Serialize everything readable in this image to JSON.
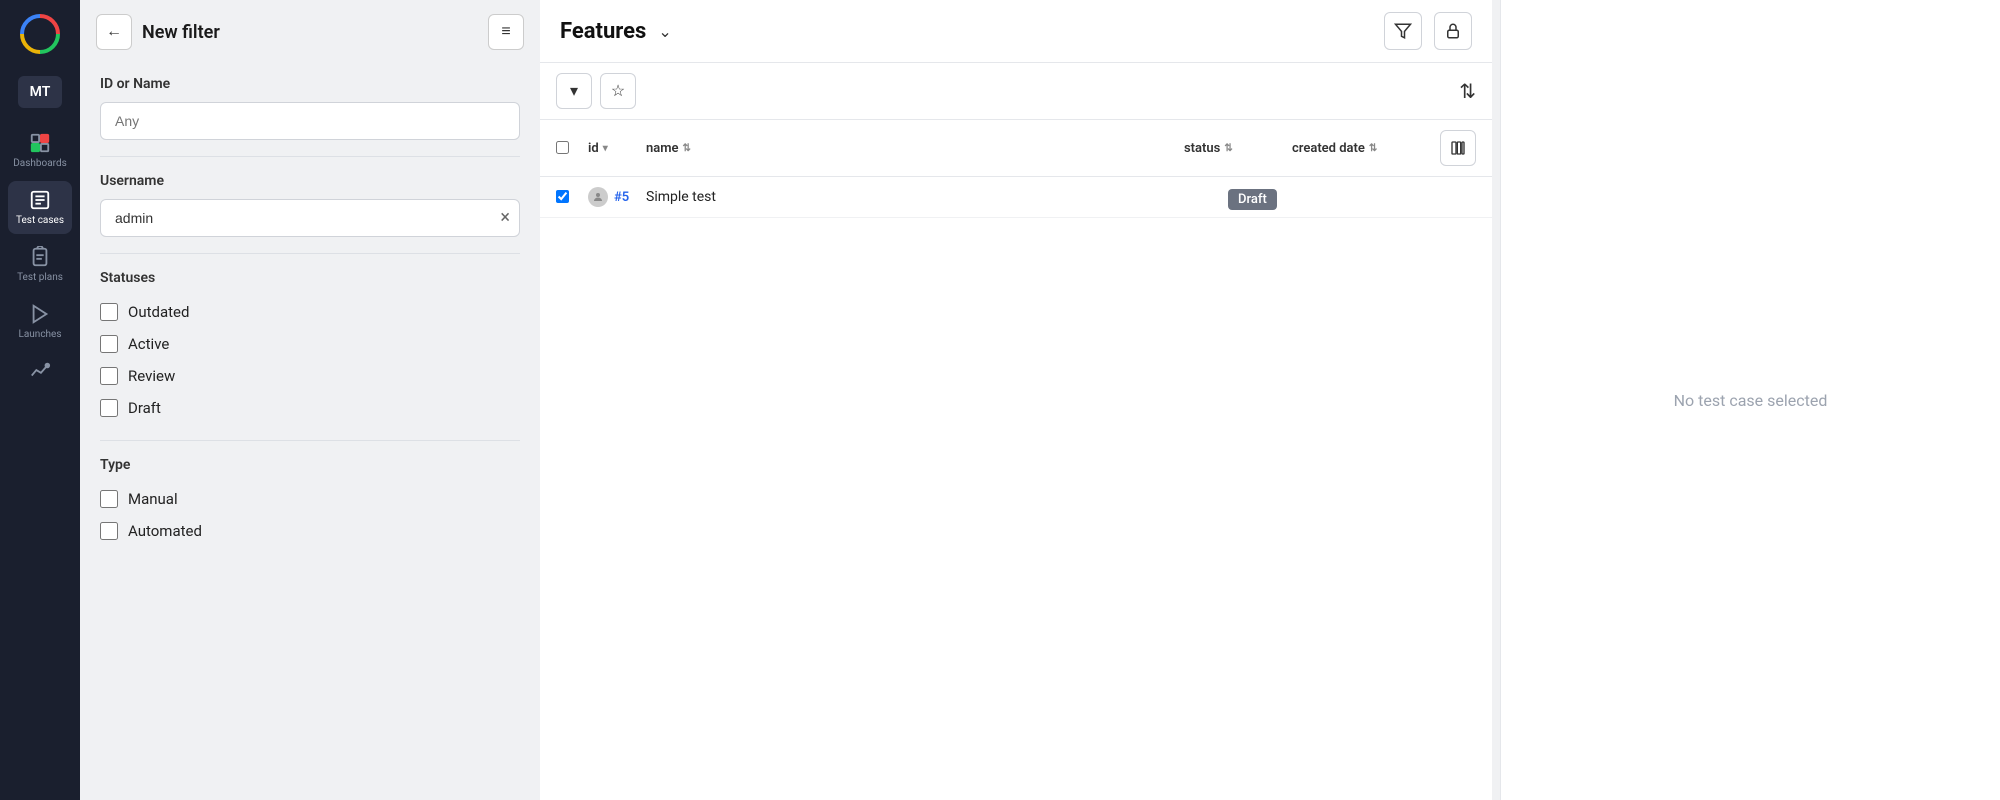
{
  "nav": {
    "logo_alt": "App logo",
    "user_badge": "MT",
    "items": [
      {
        "id": "dashboards",
        "label": "Dashboards",
        "icon": "grid-icon",
        "active": false
      },
      {
        "id": "test-cases",
        "label": "Test cases",
        "icon": "list-icon",
        "active": true
      },
      {
        "id": "test-plans",
        "label": "Test plans",
        "icon": "clipboard-icon",
        "active": false
      },
      {
        "id": "launches",
        "label": "Launches",
        "icon": "play-icon",
        "active": false
      },
      {
        "id": "analytics",
        "label": "",
        "icon": "chart-icon",
        "active": false
      }
    ]
  },
  "filter": {
    "back_label": "←",
    "title": "New filter",
    "menu_label": "≡",
    "id_or_name_label": "ID or Name",
    "id_or_name_placeholder": "Any",
    "username_label": "Username",
    "username_value": "admin",
    "statuses_label": "Statuses",
    "statuses": [
      {
        "id": "outdated",
        "label": "Outdated",
        "checked": false
      },
      {
        "id": "active",
        "label": "Active",
        "checked": false
      },
      {
        "id": "review",
        "label": "Review",
        "checked": false
      },
      {
        "id": "draft",
        "label": "Draft",
        "checked": false
      }
    ],
    "type_label": "Type",
    "types": [
      {
        "id": "manual",
        "label": "Manual",
        "checked": false
      },
      {
        "id": "automated",
        "label": "Automated",
        "checked": false
      }
    ]
  },
  "features": {
    "title": "Features",
    "filter_icon": "filter-icon",
    "lock_icon": "lock-icon",
    "toolbar": {
      "expand_label": "▾",
      "star_label": "☆",
      "sort_label": "⇅"
    },
    "table": {
      "columns": [
        {
          "id": "id",
          "label": "id"
        },
        {
          "id": "name",
          "label": "name"
        },
        {
          "id": "status",
          "label": "status"
        },
        {
          "id": "created_date",
          "label": "created date"
        }
      ],
      "rows": [
        {
          "id": 5,
          "id_display": "#5",
          "name": "Simple test",
          "status": "Draft",
          "checked": true
        }
      ]
    }
  },
  "right_panel": {
    "no_selection_text": "No test case selected"
  }
}
